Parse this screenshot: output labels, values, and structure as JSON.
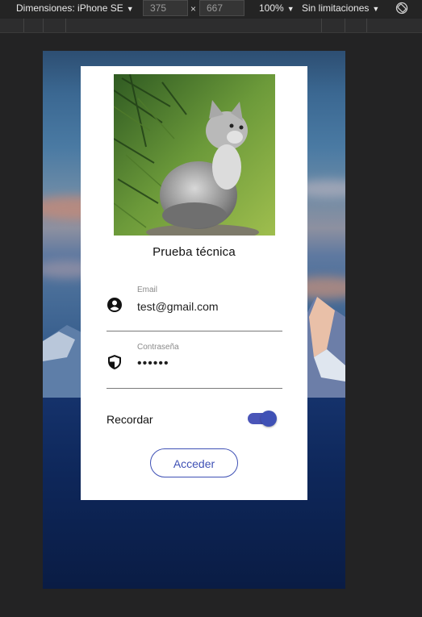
{
  "devtools": {
    "device_label": "Dimensiones: iPhone SE",
    "width_value": "375",
    "height_value": "667",
    "times_symbol": "×",
    "zoom_label": "100%",
    "throttle_label": "Sin limitaciones",
    "caret": "▼",
    "icons": {
      "dropdown": "triangle-down-icon",
      "rotate": "rotate-icon"
    }
  },
  "login": {
    "title": "Prueba técnica",
    "email": {
      "label": "Email",
      "value": "test@gmail.com",
      "icon": "account-circle-icon"
    },
    "password": {
      "label": "Contraseña",
      "value": "••••••",
      "icon": "shield-icon"
    },
    "remember": {
      "label": "Recordar",
      "enabled": true
    },
    "submit_label": "Acceder",
    "image": "kitten-photo"
  },
  "colors": {
    "accent": "#3f51b5",
    "card": "#ffffff",
    "devtools_bg": "#242424"
  }
}
